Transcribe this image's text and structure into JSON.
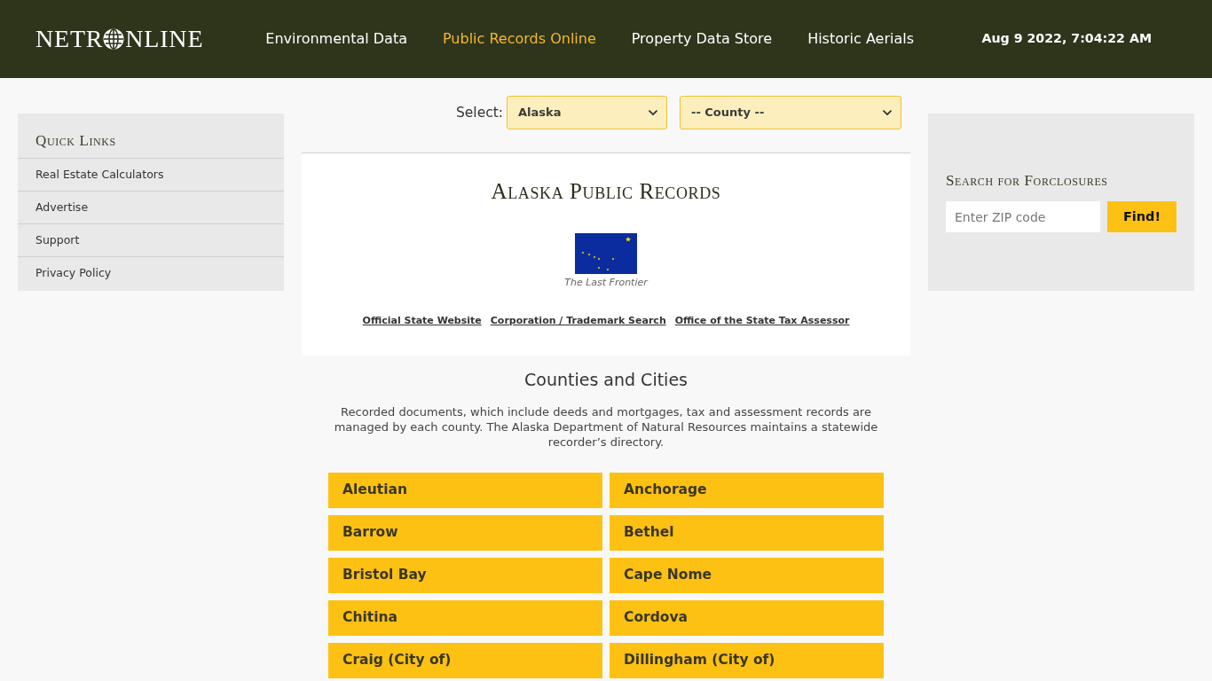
{
  "header": {
    "logo": {
      "before_globe": "NETR",
      "after_globe": "NLINE"
    },
    "nav": [
      {
        "label": "Environmental Data",
        "selected": false
      },
      {
        "label": "Public Records Online",
        "selected": true
      },
      {
        "label": "Property Data Store",
        "selected": false
      },
      {
        "label": "Historic Aerials",
        "selected": false
      }
    ],
    "datetime": "Aug 9 2022, 7:04:22 AM"
  },
  "quick_links": {
    "title": "Quick Links",
    "items": [
      "Real Estate Calculators",
      "Advertise",
      "Support",
      "Privacy Policy"
    ]
  },
  "selector": {
    "label": "Select:",
    "state_value": "Alaska",
    "county_value": "-- County --"
  },
  "records_panel": {
    "title": "Alaska Public Records",
    "flag_caption": "The Last Frontier",
    "links": [
      "Official State Website",
      "Corporation / Trademark Search",
      "Office of the State Tax Assessor"
    ]
  },
  "counties": {
    "title": "Counties and Cities",
    "description": "Recorded documents, which include deeds and mortgages, tax and assessment records are managed by each county. The Alaska Department of Natural Resources maintains a statewide recorder’s directory.",
    "items": [
      "Aleutian",
      "Anchorage",
      "Barrow",
      "Bethel",
      "Bristol Bay",
      "Cape Nome",
      "Chitina",
      "Cordova",
      "Craig (City of)",
      "Dillingham (City of)"
    ]
  },
  "foreclosure_search": {
    "title": "Search for Forclosures",
    "placeholder": "Enter ZIP code",
    "button": "Find!"
  }
}
